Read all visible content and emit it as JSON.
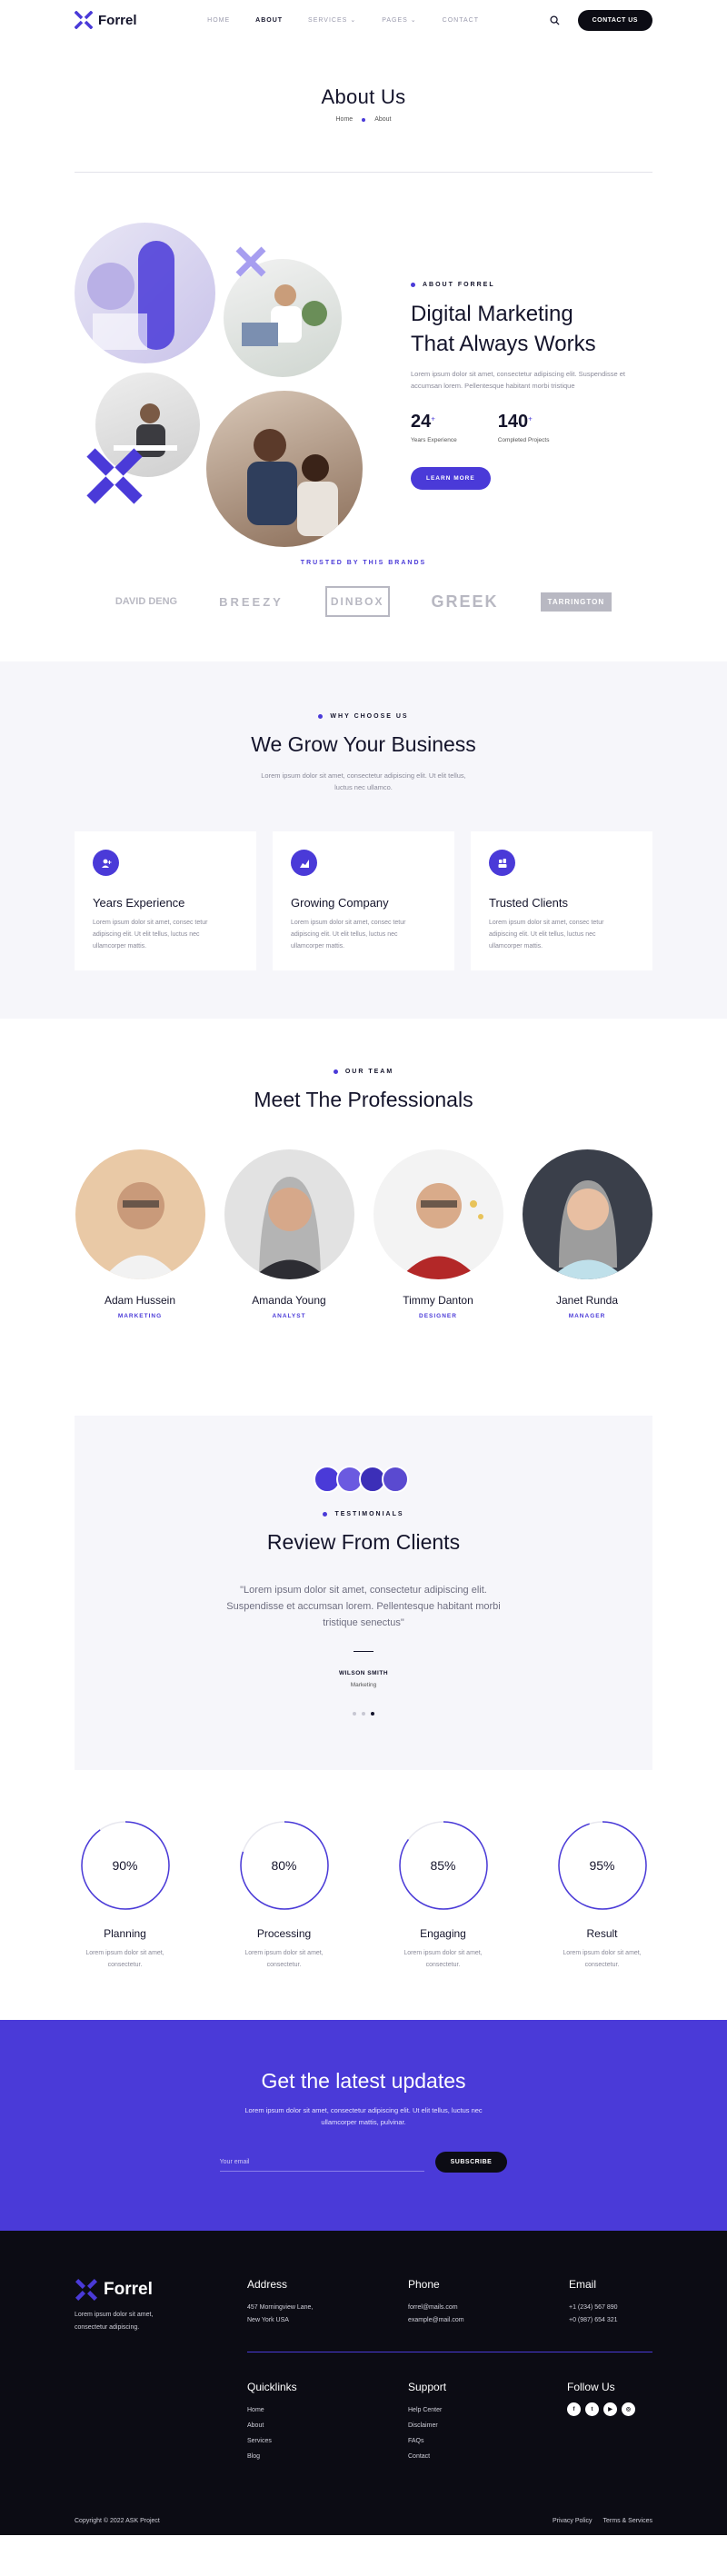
{
  "brand": {
    "name": "Forrel"
  },
  "nav": {
    "items": [
      "HOME",
      "ABOUT",
      "SERVICES",
      "PAGES",
      "CONTACT"
    ],
    "active": "ABOUT",
    "cta": "CONTACT US"
  },
  "page": {
    "title": "About Us",
    "breadcrumb": [
      "Home",
      "About"
    ]
  },
  "about": {
    "eyebrow": "ABOUT FORREL",
    "heading_line1": "Digital Marketing",
    "heading_line2": "That Always Works",
    "text": "Lorem ipsum dolor sit amet, consectetur adipiscing elit. Suspendisse et accumsan lorem. Pellentesque habitant morbi tristique",
    "stats": [
      {
        "value": "24",
        "sup": "+",
        "label": "Years Experience"
      },
      {
        "value": "140",
        "sup": "+",
        "label": "Completed Projects"
      }
    ],
    "button": "LEARN MORE"
  },
  "brands": {
    "title": "TRUSTED BY THIS BRANDS",
    "items": [
      "DAVID DENG",
      "BREEZY",
      "DINBOX",
      "GREEK",
      "TARRINGTON"
    ]
  },
  "why": {
    "eyebrow": "WHY CHOOSE US",
    "title": "We Grow Your Business",
    "lead1": "Lorem ipsum dolor sit amet, consectetur adipiscing elit. Ut elit tellus,",
    "lead2": "luctus nec ullamco.",
    "cards": [
      {
        "title": "Years Experience",
        "text1": "Lorem ipsum dolor sit amet, consec tetur",
        "text2": "adipiscing elit. Ut elit tellus, luctus nec",
        "text3": "ullamcorper mattis."
      },
      {
        "title": "Growing Company",
        "text1": "Lorem ipsum dolor sit amet, consec tetur",
        "text2": "adipiscing elit. Ut elit tellus, luctus nec",
        "text3": "ullamcorper mattis."
      },
      {
        "title": "Trusted Clients",
        "text1": "Lorem ipsum dolor sit amet, consec tetur",
        "text2": "adipiscing elit. Ut elit tellus, luctus nec",
        "text3": "ullamcorper mattis."
      }
    ]
  },
  "team": {
    "eyebrow": "OUR TEAM",
    "title": "Meet The Professionals",
    "members": [
      {
        "name": "Adam Hussein",
        "role": "MARKETING"
      },
      {
        "name": "Amanda Young",
        "role": "ANALYST"
      },
      {
        "name": "Timmy Danton",
        "role": "DESIGNER"
      },
      {
        "name": "Janet Runda",
        "role": "MANAGER"
      }
    ]
  },
  "testimonials": {
    "eyebrow": "TESTIMONIALS",
    "title": "Review From Clients",
    "quote": "\"Lorem ipsum dolor sit amet, consectetur adipiscing elit. Suspendisse et accumsan lorem. Pellentesque habitant morbi tristique senectus\"",
    "name": "WILSON SMITH",
    "role": "Marketing"
  },
  "progress": [
    {
      "value": "90%",
      "fraction": 0.9,
      "title": "Planning",
      "text1": "Lorem ipsum dolor sit amet,",
      "text2": "consectetur."
    },
    {
      "value": "80%",
      "fraction": 0.8,
      "title": "Processing",
      "text1": "Lorem ipsum dolor sit amet,",
      "text2": "consectetur."
    },
    {
      "value": "85%",
      "fraction": 0.85,
      "title": "Engaging",
      "text1": "Lorem ipsum dolor sit amet,",
      "text2": "consectetur."
    },
    {
      "value": "95%",
      "fraction": 0.95,
      "title": "Result",
      "text1": "Lorem ipsum dolor sit amet,",
      "text2": "consectetur."
    }
  ],
  "newsletter": {
    "title": "Get the latest updates",
    "text1": "Lorem ipsum dolor sit amet, consectetur adipiscing elit. Ut elit tellus, luctus nec",
    "text2": "ullamcorper mattis, pulvinar.",
    "placeholder": "Your email",
    "button": "SUBSCRIBE"
  },
  "footer": {
    "tagline1": "Lorem ipsum dolor sit amet,",
    "tagline2": "consectetur adipiscing.",
    "address": {
      "title": "Address",
      "line1": "457 Morningview Lane,",
      "line2": "New York USA"
    },
    "phone": {
      "title": "Phone",
      "line1": "forrel@mails.com",
      "line2": "example@mail.com"
    },
    "email": {
      "title": "Email",
      "line1": "+1 (234) 567 890",
      "line2": "+0 (987) 654 321"
    },
    "quicklinks": {
      "title": "Quicklinks",
      "items": [
        "Home",
        "About",
        "Services",
        "Blog"
      ]
    },
    "support": {
      "title": "Support",
      "items": [
        "Help Center",
        "Disclaimer",
        "FAQs",
        "Contact"
      ]
    },
    "follow": {
      "title": "Follow Us",
      "icons": [
        "facebook-icon",
        "twitter-icon",
        "youtube-icon",
        "instagram-icon"
      ]
    },
    "copyright": "Copyright © 2022 ASK Project",
    "links": [
      "Privacy Policy",
      "Terms & Services"
    ]
  },
  "colors": {
    "accent": "#4a3ad8",
    "dark": "#0c0c14",
    "soft": "#f6f6fa"
  }
}
